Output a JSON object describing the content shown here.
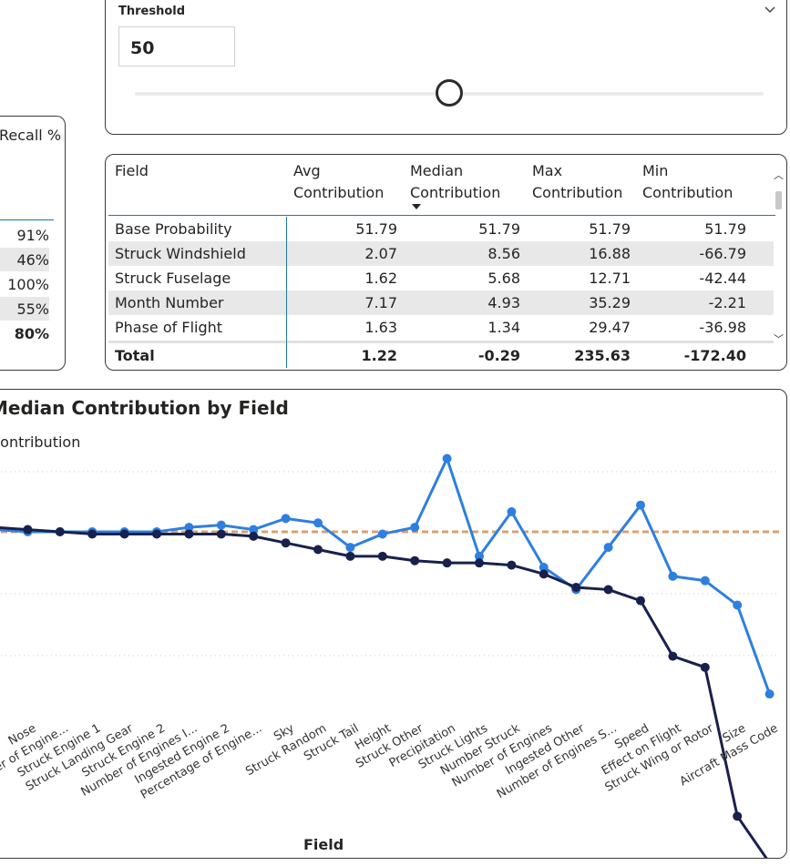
{
  "threshold": {
    "title": "Threshold",
    "value": "50",
    "slider_fraction": 0.5,
    "chevron": "chevron-down-icon"
  },
  "recall": {
    "header": "Recall %",
    "rows": [
      "91%",
      "46%",
      "100%",
      "55%"
    ],
    "total": "80%"
  },
  "table": {
    "headers": {
      "field": "Field",
      "avg": [
        "Avg",
        "Contribution"
      ],
      "median": [
        "Median",
        "Contribution"
      ],
      "max": [
        "Max",
        "Contribution"
      ],
      "min": [
        "Min",
        "Contribution"
      ]
    },
    "sorted_column": "median",
    "rows": [
      {
        "field": "Base Probability",
        "avg": "51.79",
        "median": "51.79",
        "max": "51.79",
        "min": "51.79"
      },
      {
        "field": "Struck Windshield",
        "avg": "2.07",
        "median": "8.56",
        "max": "16.88",
        "min": "-66.79"
      },
      {
        "field": "Struck Fuselage",
        "avg": "1.62",
        "median": "5.68",
        "max": "12.71",
        "min": "-42.44"
      },
      {
        "field": "Month Number",
        "avg": "7.17",
        "median": "4.93",
        "max": "35.29",
        "min": "-2.21"
      },
      {
        "field": "Phase of Flight",
        "avg": "1.63",
        "median": "1.34",
        "max": "29.47",
        "min": "-36.98"
      }
    ],
    "total": {
      "field": "Total",
      "avg": "1.22",
      "median": "-0.29",
      "max": "235.63",
      "min": "-172.40"
    }
  },
  "chart": {
    "title": "Median Contribution by Field",
    "ylabel": "Contribution",
    "xlabel": "Field"
  },
  "chart_data": {
    "type": "line",
    "categories": [
      "Nose",
      "Number of Engine...",
      "Struck Engine 1",
      "Struck Landing Gear",
      "Struck Engine 2",
      "Number of Engines I...",
      "Ingested Engine 2",
      "Percentage of Engine...",
      "Sky",
      "Struck Random",
      "Struck Tail",
      "Height",
      "Struck Other",
      "Precipitation",
      "Struck Lights",
      "Number Struck",
      "Number of Engines",
      "Ingested Other",
      "Number of Engines S...",
      "Speed",
      "Effect on Flight",
      "Struck Wing or Rotor",
      "Size",
      "Aircraft Mass Code"
    ],
    "series": [
      {
        "color": "#1f3fbf",
        "values": [
          0.1,
          0.0,
          0.0,
          0.0,
          0.0,
          0.0,
          0.2,
          0.3,
          0.1,
          0.6,
          0.4,
          -0.7,
          -0.1,
          0.2,
          3.3,
          -1.1,
          0.9,
          -1.6,
          -2.6,
          -0.7,
          1.2,
          -2.0,
          -2.2,
          -3.3,
          -7.3
        ]
      },
      {
        "color": "#18214d",
        "values": [
          0.2,
          0.1,
          0.0,
          -0.1,
          -0.1,
          -0.1,
          -0.1,
          -0.1,
          -0.2,
          -0.5,
          -0.8,
          -1.1,
          -1.1,
          -1.3,
          -1.4,
          -1.4,
          -1.5,
          -1.9,
          -2.5,
          -2.6,
          -3.1,
          -5.6,
          -6.1,
          -12.8,
          -14.9
        ]
      }
    ],
    "reference_line": {
      "value": 0.0,
      "color": "#d8a272",
      "style": "dashed"
    },
    "grid": true
  }
}
